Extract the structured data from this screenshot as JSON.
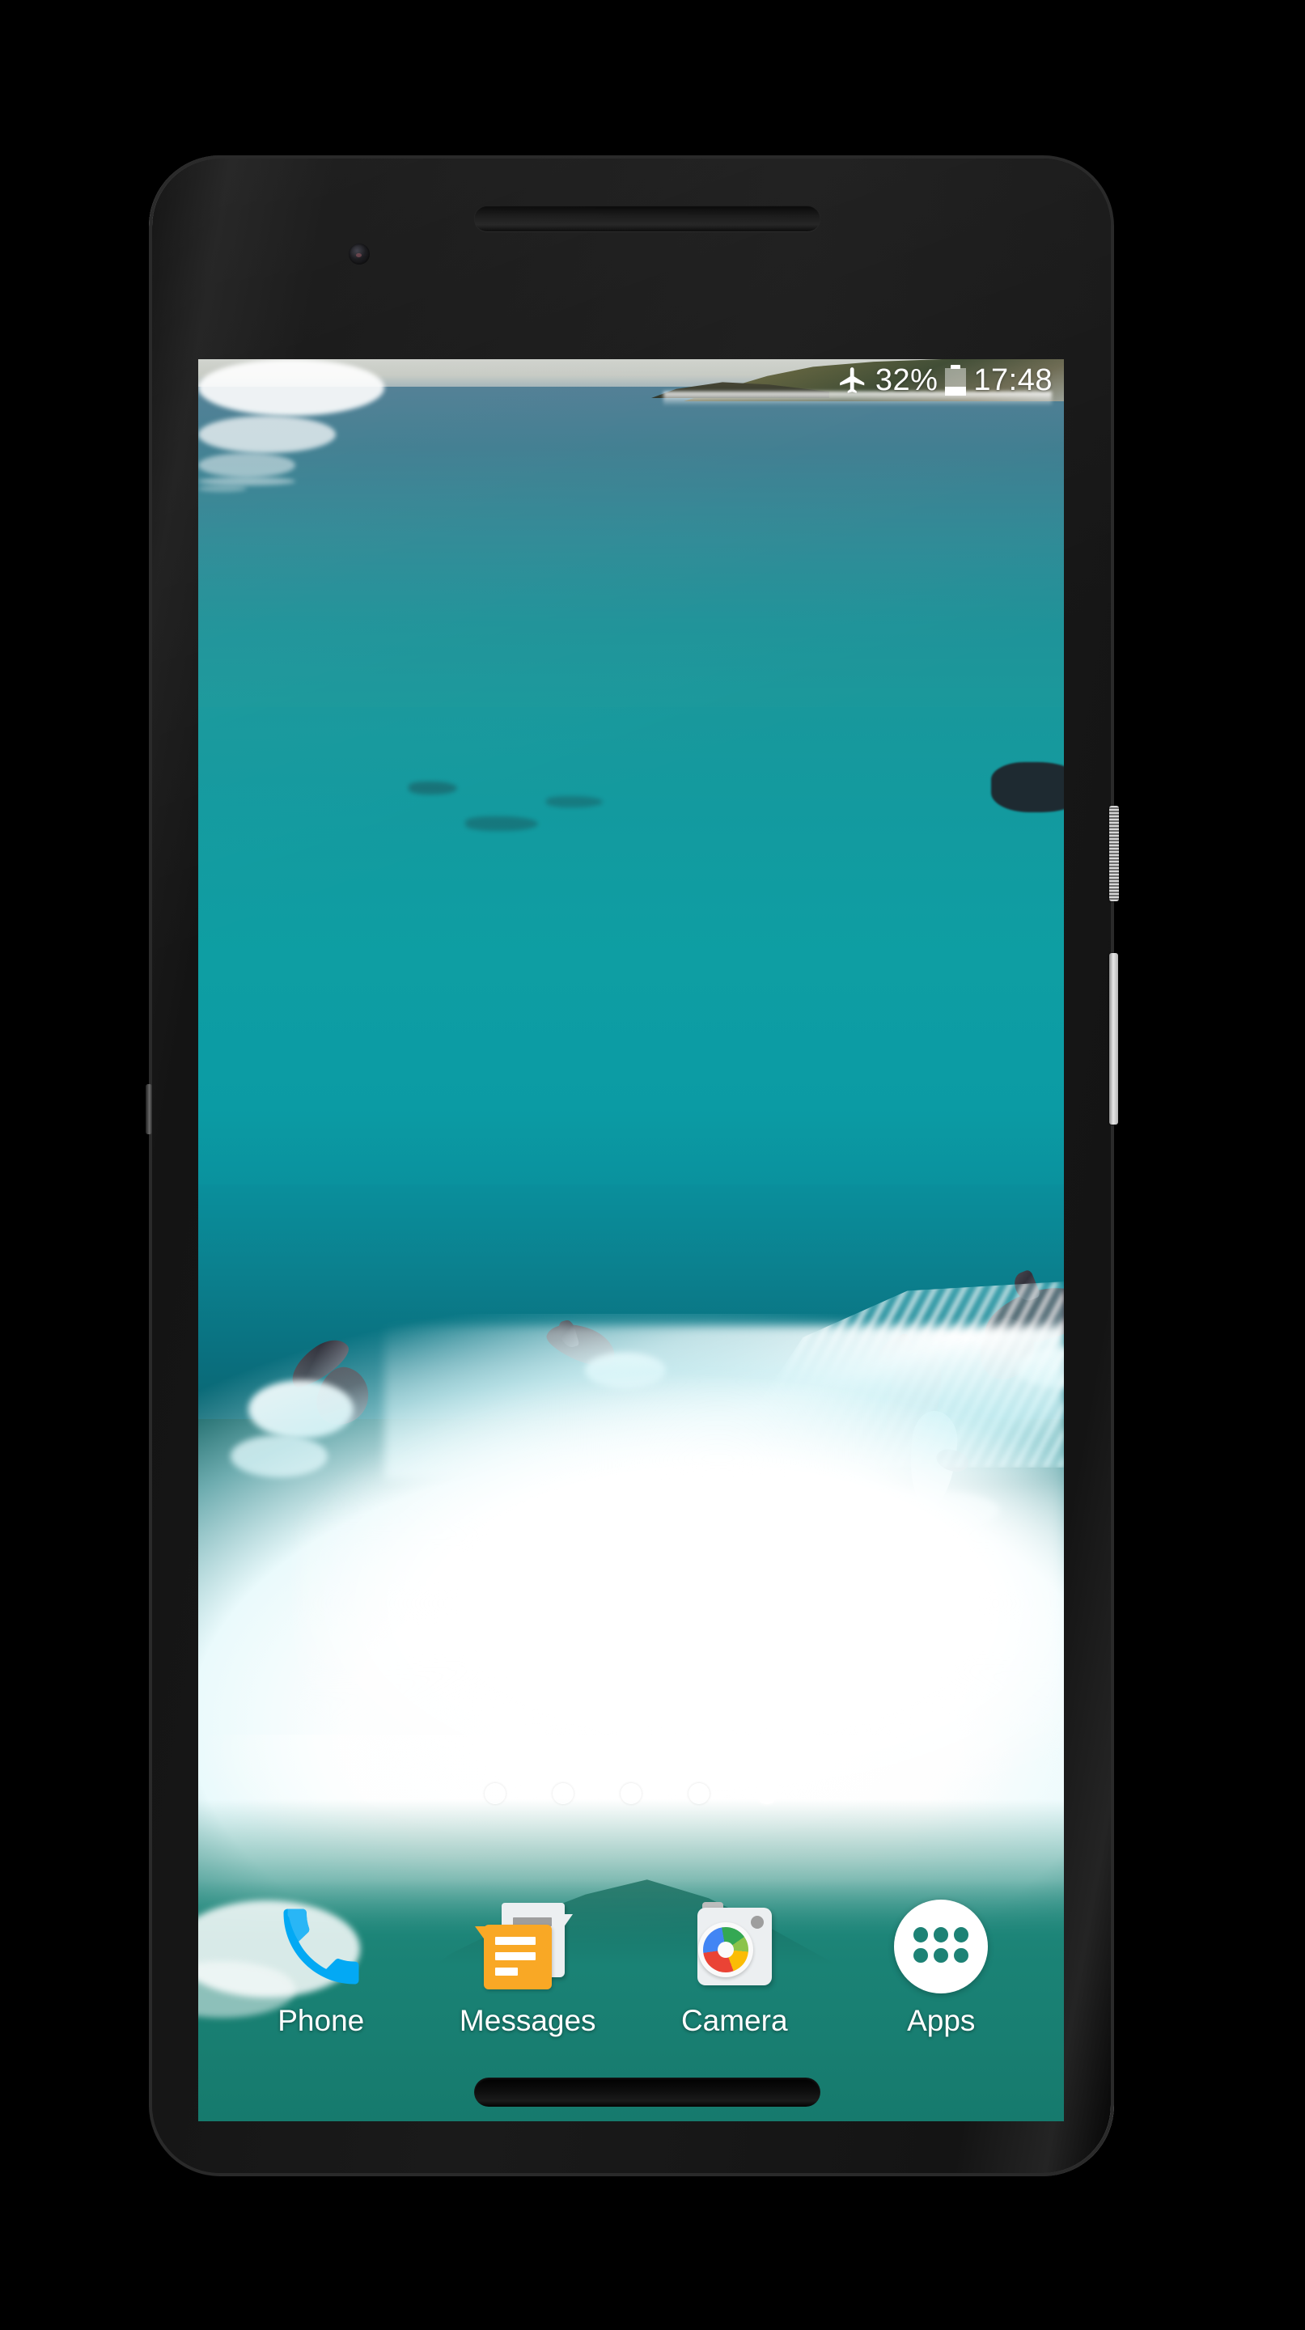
{
  "device": {
    "type": "android-smartphone",
    "body_color": "#141414",
    "frame_accent": "#c9c9c9",
    "hardware": {
      "earpiece": "earpiece-speaker",
      "front_camera": "front-camera-lens",
      "bottom_speaker": "bottom-speaker",
      "power_button": "power-button",
      "volume_button": "volume-rocker"
    }
  },
  "screen": {
    "wallpaper": {
      "kind": "live-video-wallpaper",
      "subject": "dolphins surfing a breaking ocean wave",
      "colors": {
        "sky": "#cfd2cc",
        "deep_water": "#3f7d90",
        "mid_water": "#0e9ea3",
        "foam": "#ffffff",
        "foreground_water": "#1a8275",
        "headland": "#5d5f3b"
      },
      "dolphin_count": 5
    },
    "status_bar": {
      "airplane_mode_icon": "airplane-icon",
      "battery_percent": "32%",
      "battery_icon": "battery-icon",
      "battery_level_fraction": 0.32,
      "clock": "17:48",
      "text_color": "#ffffff"
    },
    "page_indicator": {
      "total_pages": 5,
      "active_page": 5,
      "dots": [
        {
          "state": "faint"
        },
        {
          "state": "faint"
        },
        {
          "state": "inactive"
        },
        {
          "state": "inactive"
        },
        {
          "state": "active"
        }
      ]
    },
    "dock": {
      "items": [
        {
          "label": "Phone",
          "icon": "phone-icon",
          "accent": "#2196f3"
        },
        {
          "label": "Messages",
          "icon": "messages-icon",
          "accent": "#f9a825"
        },
        {
          "label": "Camera",
          "icon": "camera-icon",
          "accent": "#eceff1"
        },
        {
          "label": "Apps",
          "icon": "apps-grid-icon",
          "accent": "#ffffff"
        }
      ]
    }
  }
}
